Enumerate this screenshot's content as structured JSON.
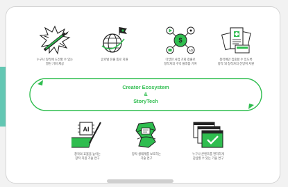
{
  "diagram": {
    "title_line1": "Creator Ecosystem",
    "title_amp": "&",
    "title_line2": "StoryTech",
    "top_items": [
      {
        "icon": "pen-burst-icon",
        "caption": "누구나 창작에 도전할 수 있는\n열린 기회 제공"
      },
      {
        "icon": "globe-flag-icon",
        "caption": "글로벌 진출 통로 지원"
      },
      {
        "icon": "creator-network-icon",
        "caption": "다양한 사업 기회 창출로\n창작자의 수익 플래폼 기여"
      },
      {
        "icon": "documents-icon",
        "caption": "창작에만 집중할 수 있도록\n창작 외 창작자의 전방위 지원"
      }
    ],
    "bottom_items": [
      {
        "icon": "ai-tablet-icon",
        "caption": "창작의 효율을 높이는\n창작 지원 기술 연구"
      },
      {
        "icon": "content-shield-icon",
        "caption": "창작 생태계를 보호하는\n기술 연구"
      },
      {
        "icon": "browser-windows-icon",
        "caption": "누구나 콘텐츠를 편하하게\n감상할 수 있는 기술 연구"
      }
    ],
    "colors": {
      "accent": "#2fbd4f",
      "ink": "#222222",
      "teal": "#63c7b3"
    }
  }
}
